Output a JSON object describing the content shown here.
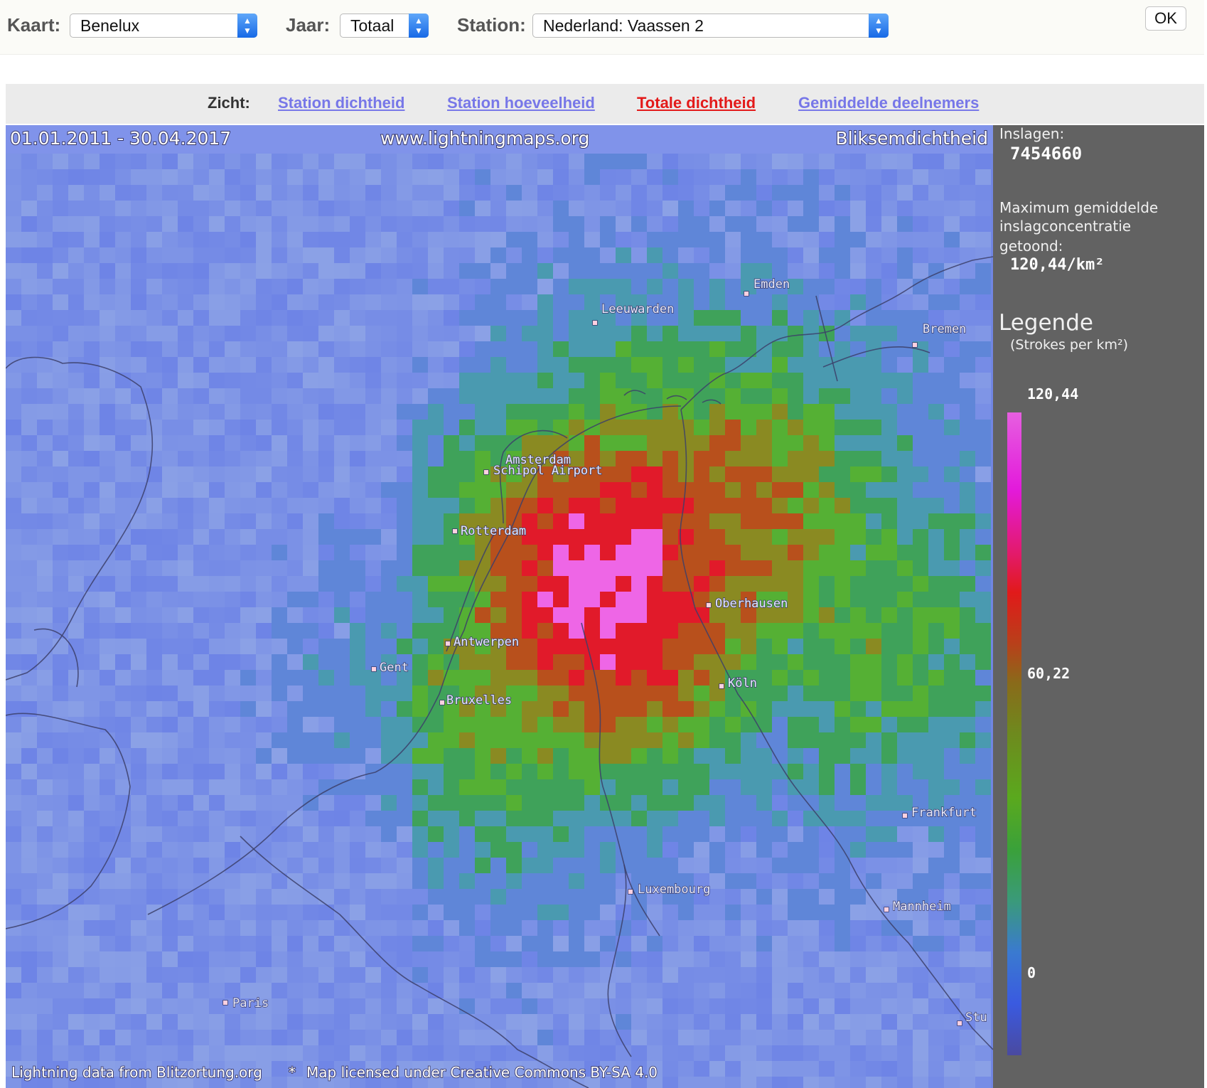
{
  "controls": {
    "kaart_label": "Kaart:",
    "kaart_value": "Benelux",
    "jaar_label": "Jaar:",
    "jaar_value": "Totaal",
    "station_label": "Station:",
    "station_value": "Nederland: Vaassen 2",
    "ok_label": "OK"
  },
  "views": {
    "label": "Zicht:",
    "items": [
      {
        "label": "Station dichtheid",
        "active": false
      },
      {
        "label": "Station hoeveelheid",
        "active": false
      },
      {
        "label": "Totale dichtheid",
        "active": true
      },
      {
        "label": "Gemiddelde deelnemers",
        "active": false
      }
    ]
  },
  "map": {
    "date_range": "01.01.2011 - 30.04.2017",
    "site": "www.lightningmaps.org",
    "map_title": "Bliksemdichtheid",
    "attribution_left": "Lightning data from Blitzortung.org",
    "attribution_right": "Map licensed under Creative Commons BY-SA 4.0",
    "cities": [
      "Emden",
      "Leeuwarden",
      "Bremen",
      "Amsterdam",
      "Schipol Airport",
      "Rotterdam",
      "Oberhausen",
      "Antwerpen",
      "Gent",
      "Bruxelles",
      "Köln",
      "Frankfurt",
      "Luxembourg",
      "Mannheim",
      "Paris",
      "Stu"
    ]
  },
  "panel": {
    "inslagen_label": "Inslagen:",
    "inslagen_value": "7454660",
    "max_line1": "Maximum gemiddelde",
    "max_line2": "inslagconcentratie",
    "max_line3": "getoond:",
    "max_value": "120,44/km²",
    "legend_title": "Legende",
    "legend_unit": "(Strokes per km²)",
    "legend_max": "120,44",
    "legend_mid": "60,22",
    "legend_min": "0"
  },
  "colors": {
    "background_blue": "#6f86e6",
    "active_link": "#e31a1a",
    "link": "#7777e8",
    "panel": "#626262"
  }
}
